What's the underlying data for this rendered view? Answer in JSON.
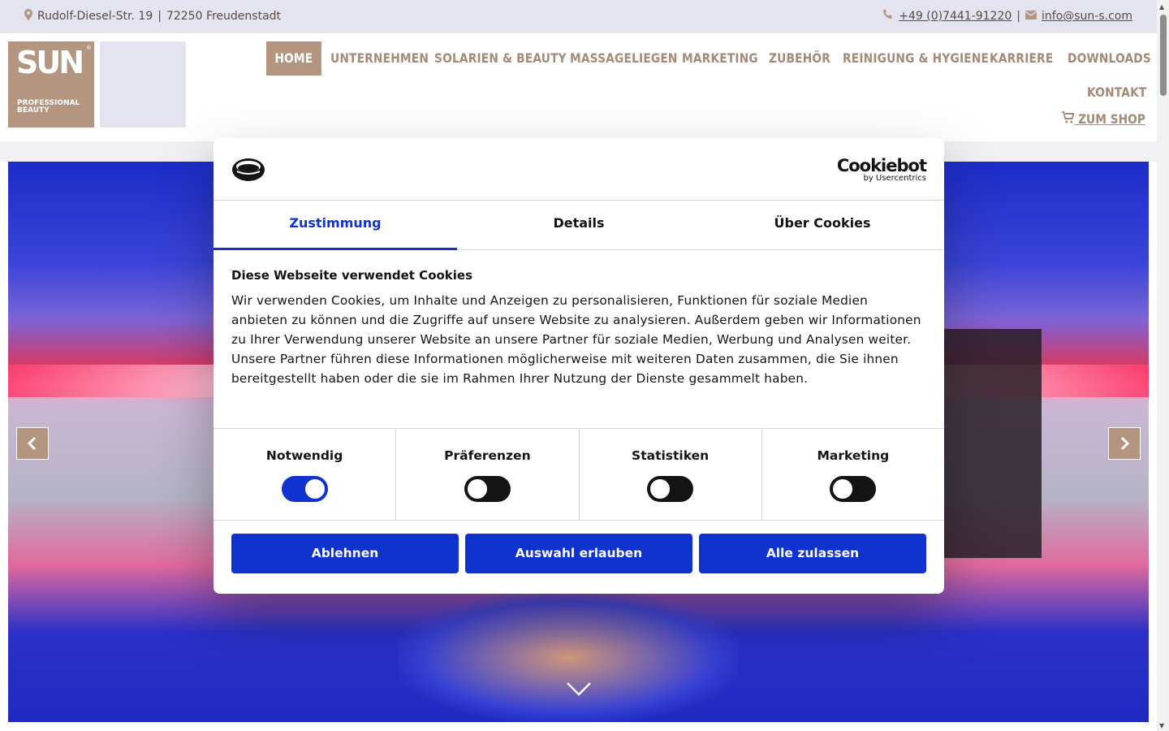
{
  "topbar": {
    "address_street": "Rudolf-Diesel-Str. 19",
    "separator": "|",
    "address_city": "72250 Freudenstadt",
    "phone": "+49 (0)7441-91220",
    "email": "info@sun-s.com"
  },
  "logo": {
    "brand": "SUN",
    "line1": "PROFESSIONAL",
    "line2": "BEAUTY",
    "reg": "®"
  },
  "nav": {
    "items": [
      {
        "label": "HOME",
        "active": true
      },
      {
        "label": "UNTERNEHMEN"
      },
      {
        "label": "SOLARIEN & BEAUTY"
      },
      {
        "label": "MASSAGELIEGEN"
      },
      {
        "label": "MARKETING"
      },
      {
        "label": "ZUBEHÖR"
      },
      {
        "label": "REINIGUNG & HYGIENE"
      },
      {
        "label": "KARRIERE"
      },
      {
        "label": "DOWNLOADS"
      },
      {
        "label": "KONTAKT"
      }
    ],
    "shop_label": " ZUM SHOP"
  },
  "colors": {
    "brand": "#b39580",
    "topbar_bg": "#e4e4f1",
    "cookie_blue": "#1032cf"
  },
  "cookie": {
    "brand_name": "Cookiebot",
    "brand_sub": "by Usercentrics",
    "tabs": [
      "Zustimmung",
      "Details",
      "Über Cookies"
    ],
    "active_tab": "Zustimmung",
    "heading": "Diese Webseite verwendet Cookies",
    "text": "Wir verwenden Cookies, um Inhalte und Anzeigen zu personalisieren, Funktionen für soziale Medien anbieten zu können und die Zugriffe auf unsere Website zu analysieren. Außerdem geben wir Informationen zu Ihrer Verwendung unserer Website an unsere Partner für soziale Medien, Werbung und Analysen weiter. Unsere Partner führen diese Informationen möglicherweise mit weiteren Daten zusammen, die Sie ihnen bereitgestellt haben oder die sie im Rahmen Ihrer Nutzung der Dienste gesammelt haben.",
    "toggles": [
      {
        "label": "Notwendig",
        "on": true
      },
      {
        "label": "Präferenzen",
        "on": false
      },
      {
        "label": "Statistiken",
        "on": false
      },
      {
        "label": "Marketing",
        "on": false
      }
    ],
    "buttons": [
      "Ablehnen",
      "Auswahl erlauben",
      "Alle zulassen"
    ]
  },
  "icons": {
    "address": "map-marker-icon",
    "phone": "phone-icon",
    "email": "envelope-icon",
    "cart": "shopping-cart-icon",
    "prev": "chevron-left-icon",
    "next": "chevron-right-icon",
    "scroll": "chevron-down-icon"
  }
}
